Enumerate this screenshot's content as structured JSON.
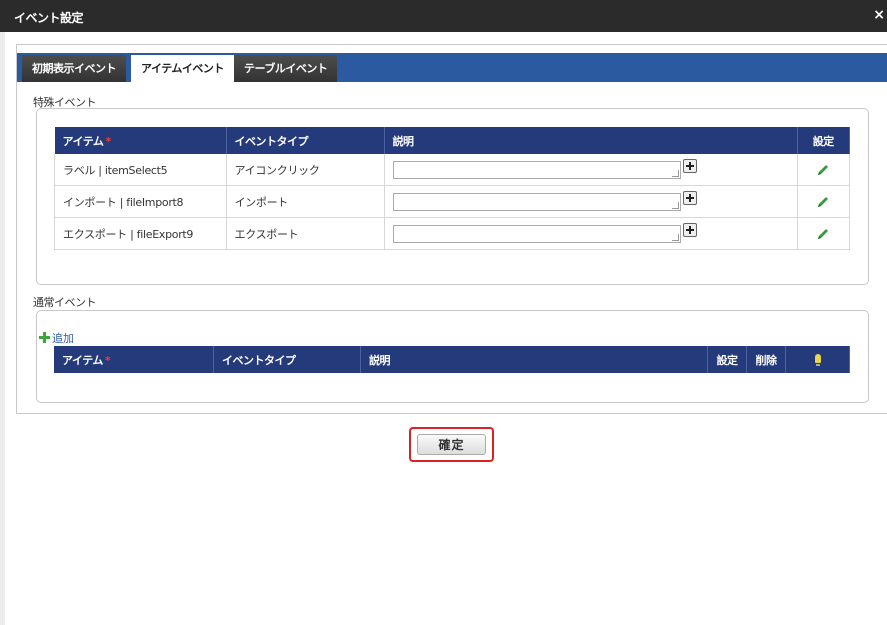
{
  "window": {
    "title": "イベント設定",
    "close_label": "×"
  },
  "tabs": [
    {
      "label": "初期表示イベント",
      "active": false
    },
    {
      "label": "アイテムイベント",
      "active": true
    },
    {
      "label": "テーブルイベント",
      "active": false
    }
  ],
  "special_section": {
    "label": "特殊イベント",
    "columns": {
      "item": "アイテム",
      "required_mark": "*",
      "event_type": "イベントタイプ",
      "description": "説明",
      "settings": "設定"
    },
    "rows": [
      {
        "item": "ラベル | itemSelect5",
        "event_type": "アイコンクリック",
        "description": ""
      },
      {
        "item": "インポート | fileImport8",
        "event_type": "インポート",
        "description": ""
      },
      {
        "item": "エクスポート | fileExport9",
        "event_type": "エクスポート",
        "description": ""
      }
    ]
  },
  "normal_section": {
    "label": "通常イベント",
    "add_label": "追加",
    "columns": {
      "item": "アイテム",
      "required_mark": "*",
      "event_type": "イベントタイプ",
      "description": "説明",
      "settings": "設定",
      "delete": "削除"
    }
  },
  "footer": {
    "confirm_label": "確定"
  },
  "colors": {
    "header_bg": "#243a7a",
    "tabbar_bg": "#2c5aa0",
    "titlebar_bg": "#2b2b2b",
    "highlight": "#dd2222",
    "pencil": "#3a9a3a"
  },
  "icons": {
    "close": "close-icon",
    "plus": "plus-icon",
    "edit": "pencil-icon",
    "add": "add-icon",
    "hint": "lightbulb-icon"
  }
}
